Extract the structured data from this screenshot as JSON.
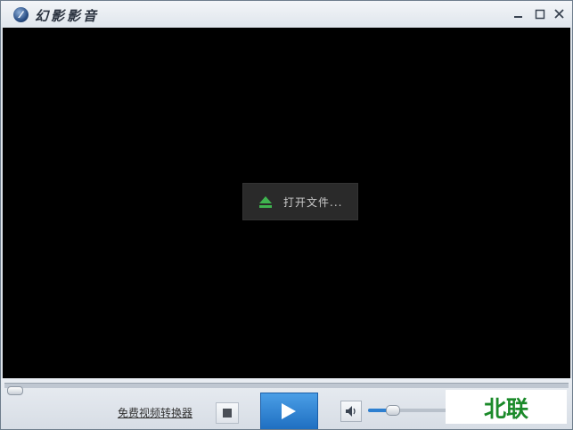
{
  "app": {
    "title": "幻影影音"
  },
  "window_controls": {
    "minimize_icon": "minimize-icon",
    "maximize_icon": "maximize-icon",
    "close_icon": "close-icon"
  },
  "video": {
    "open_file_label": "打开文件...",
    "open_icon": "eject-icon"
  },
  "controls": {
    "convert_link": "免费视频转换器",
    "stop_icon": "stop-icon",
    "play_icon": "play-icon",
    "volume_icon": "speaker-icon",
    "volume_level": 0.3,
    "seek_position": 0
  },
  "watermark": {
    "text": "北联"
  },
  "colors": {
    "play_button": "#2a7fd4",
    "open_icon": "#3fb34f",
    "watermark": "#1b8a2a"
  }
}
